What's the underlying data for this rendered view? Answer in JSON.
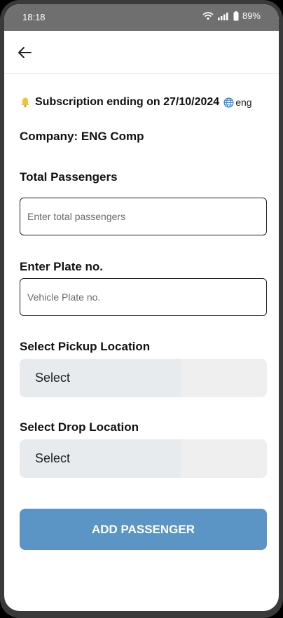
{
  "status_bar": {
    "time": "18:18",
    "battery": "89%",
    "icons": [
      "wifi-icon",
      "signal-icon",
      "battery-icon"
    ]
  },
  "app_bar": {
    "back_icon": "arrow-left-icon"
  },
  "subscription": {
    "icon": "bell-icon",
    "text": "Subscription ending on 27/10/2024",
    "language_icon": "globe-icon",
    "language": "eng"
  },
  "company": {
    "text": "Company: ENG Comp"
  },
  "form": {
    "total_passengers_label": "Total Passengers",
    "total_passengers_placeholder": "Enter total passengers",
    "total_passengers_value": "",
    "plate_label": "Enter Plate no.",
    "plate_placeholder": "Vehicle Plate no.",
    "plate_value": "",
    "pickup_label": "Select Pickup Location",
    "pickup_value": "Select",
    "drop_label": "Select Drop Location",
    "drop_value": "Select",
    "submit_label": "ADD PASSENGER"
  },
  "colors": {
    "primary_button": "#5a95c5",
    "status_bar": "#6f6f6f",
    "select_background": "#efefef"
  }
}
